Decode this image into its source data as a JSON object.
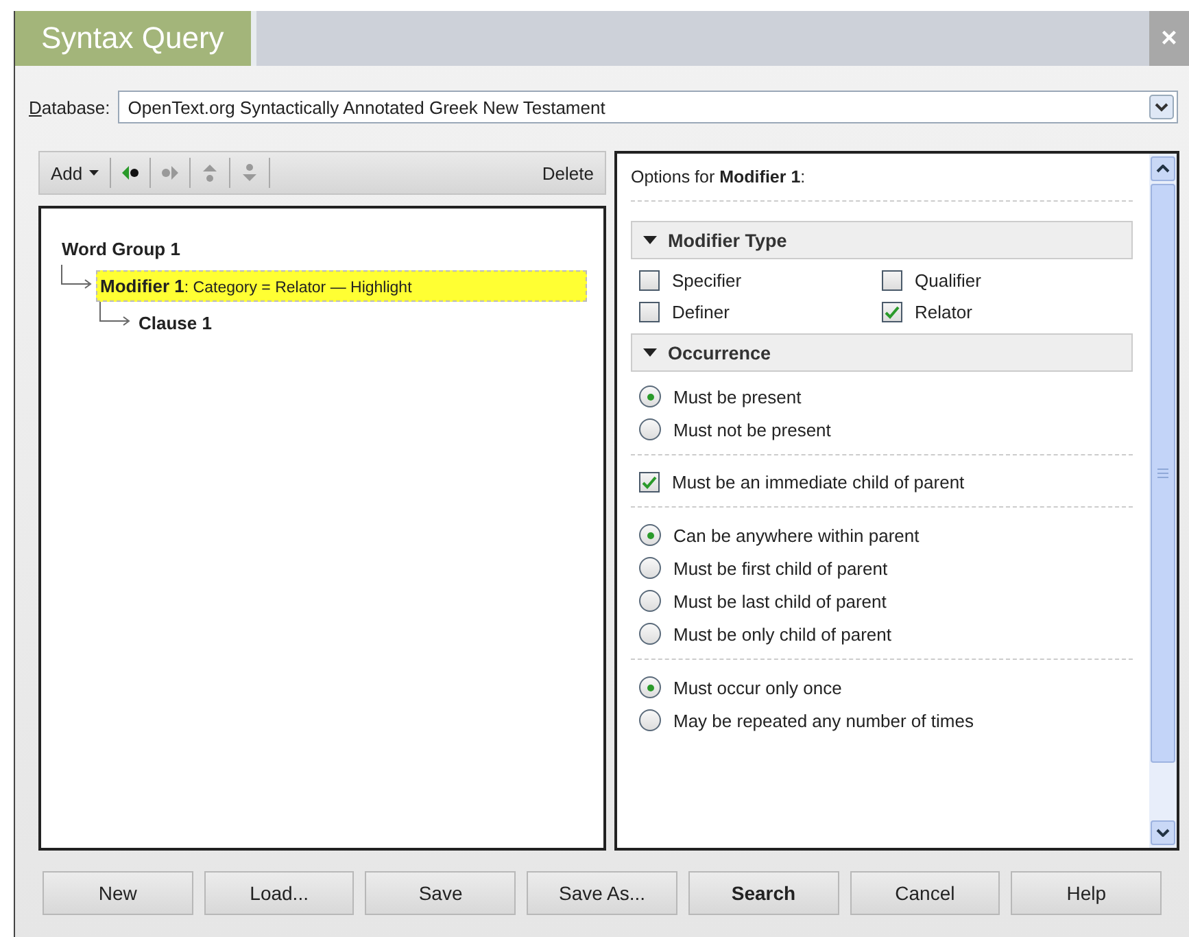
{
  "window": {
    "title": "Syntax Query",
    "close": "×"
  },
  "database": {
    "label": "Database:",
    "value": "OpenText.org Syntactically Annotated Greek New Testament"
  },
  "toolbar": {
    "add": "Add",
    "delete": "Delete",
    "tools": [
      {
        "kind": "left",
        "disabled": false
      },
      {
        "kind": "right",
        "disabled": true
      },
      {
        "kind": "up",
        "disabled": true
      },
      {
        "kind": "down",
        "disabled": true
      }
    ]
  },
  "tree": [
    {
      "name": "Word Group 1",
      "selected": false,
      "children": [
        {
          "name": "Modifier 1",
          "detail": ": Category = Relator — Highlight",
          "selected": true,
          "children": [
            {
              "name": "Clause 1",
              "selected": false
            }
          ]
        }
      ]
    }
  ],
  "options": {
    "heading": "Options for **Modifier 1**:",
    "blocks": [
      {
        "kind": "section",
        "title": "Modifier Type",
        "expanded": true
      },
      {
        "kind": "checkgrid",
        "items": [
          {
            "label": "Specifier",
            "checked": false
          },
          {
            "label": "Qualifier",
            "checked": false
          },
          {
            "label": "Definer",
            "checked": false
          },
          {
            "label": "Relator",
            "checked": true
          }
        ]
      },
      {
        "kind": "section",
        "title": "Occurrence",
        "expanded": true
      },
      {
        "kind": "radios",
        "items": [
          {
            "label": "Must be present",
            "selected": true
          },
          {
            "label": "Must not be present",
            "selected": false
          }
        ]
      },
      {
        "kind": "divider"
      },
      {
        "kind": "checks",
        "items": [
          {
            "label": "Must be an immediate child of parent",
            "checked": true
          }
        ]
      },
      {
        "kind": "divider"
      },
      {
        "kind": "radios",
        "items": [
          {
            "label": "Can be anywhere within parent",
            "selected": true
          },
          {
            "label": "Must be first child of parent",
            "selected": false
          },
          {
            "label": "Must be last child of parent",
            "selected": false
          },
          {
            "label": "Must be only child of parent",
            "selected": false
          }
        ]
      },
      {
        "kind": "divider"
      },
      {
        "kind": "radios",
        "items": [
          {
            "label": "Must occur only once",
            "selected": true
          },
          {
            "label": "May be repeated any number of times",
            "selected": false
          }
        ]
      }
    ]
  },
  "buttons": [
    {
      "label": "New",
      "default": false
    },
    {
      "label": "Load...",
      "default": false
    },
    {
      "label": "Save",
      "default": false
    },
    {
      "label": "Save As...",
      "default": false
    },
    {
      "label": "Search",
      "default": true
    },
    {
      "label": "Cancel",
      "default": false
    },
    {
      "label": "Help",
      "default": false
    }
  ]
}
